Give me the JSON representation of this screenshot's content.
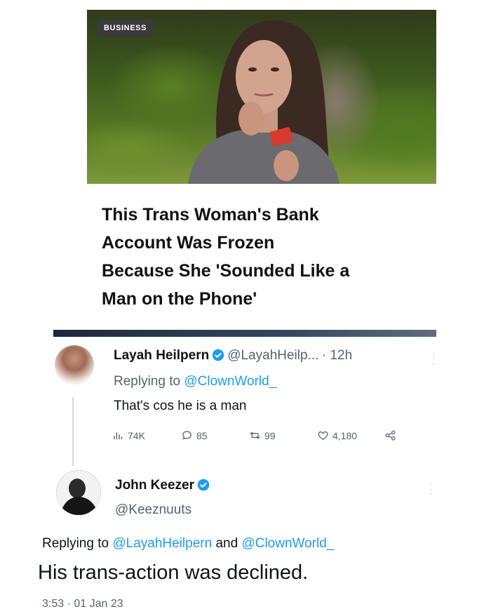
{
  "article": {
    "category": "BUSINESS",
    "headline_lines": [
      "This Trans Woman's Bank",
      "Account Was Frozen",
      "Because She 'Sounded Like a",
      "Man on the Phone'"
    ]
  },
  "tweet1": {
    "name": "Layah Heilpern",
    "handle": "@LayahHeilp...",
    "time": "· 12h",
    "replying_prefix": "Replying to ",
    "replying_to": "@ClownWorld_",
    "text": "That's cos he is a man",
    "stats": {
      "views": "74K",
      "replies": "85",
      "retweets": "99",
      "likes": "4,180"
    }
  },
  "tweet2": {
    "name": "John Keezer",
    "handle": "@Keeznuuts",
    "replying_prefix": "Replying to ",
    "replying_to_1": "@LayahHeilpern",
    "replying_joiner": " and ",
    "replying_to_2": "@ClownWorld_",
    "text": "His trans-action was declined.",
    "timestamp": "3:53 · 01 Jan 23"
  },
  "colors": {
    "link": "#1d9bf0",
    "verified": "#1d9bf0",
    "secondary_text": "#536471"
  },
  "icons": [
    "verified-badge-icon",
    "views-icon",
    "reply-icon",
    "retweet-icon",
    "like-icon",
    "share-icon",
    "more-icon"
  ]
}
